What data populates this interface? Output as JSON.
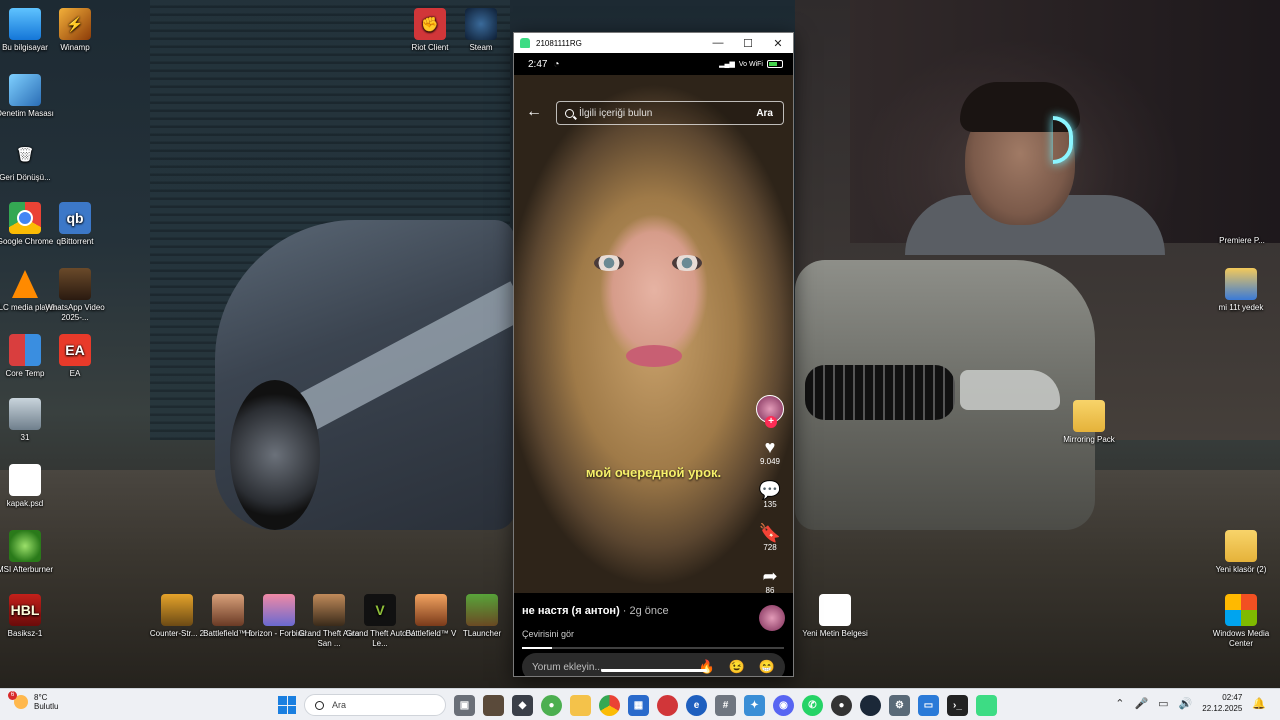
{
  "desktop": {
    "left_icons": [
      {
        "label": "Bu bilgisayar",
        "icon": "computer-icon"
      },
      {
        "label": "Winamp",
        "icon": "winamp-icon"
      },
      {
        "label": "Denetim Masası",
        "icon": "control-panel-icon"
      },
      {
        "label": "Geri Dönüşü...",
        "icon": "recycle-bin-icon"
      },
      {
        "label": "Google Chrome",
        "icon": "chrome-icon"
      },
      {
        "label": "qBittorrent",
        "icon": "qbittorrent-icon"
      },
      {
        "label": "VLC media player",
        "icon": "vlc-icon"
      },
      {
        "label": "WhatsApp Video 2025-...",
        "icon": "video-file-icon"
      },
      {
        "label": "Core Temp",
        "icon": "core-temp-icon"
      },
      {
        "label": "EA",
        "icon": "ea-icon"
      },
      {
        "label": "31",
        "icon": "image-file-icon"
      },
      {
        "label": "kapak.psd",
        "icon": "psd-file-icon"
      },
      {
        "label": "MSI Afterburner",
        "icon": "msi-afterburner-icon"
      },
      {
        "label": "Basiksz-1",
        "icon": "image-file-icon"
      }
    ],
    "top_icons": [
      {
        "label": "Riot Client",
        "icon": "riot-icon"
      },
      {
        "label": "Steam",
        "icon": "steam-icon"
      }
    ],
    "bottom_icons": [
      {
        "label": "Counter-Str... 2",
        "icon": "cs2-icon"
      },
      {
        "label": "Battlefield™ 1",
        "icon": "battlefield-1-icon"
      },
      {
        "label": "Horizon - Forbidd...",
        "icon": "horizon-icon"
      },
      {
        "label": "Grand Theft Auto San ...",
        "icon": "gta-sa-icon"
      },
      {
        "label": "Grand Theft Auto V Le...",
        "icon": "gta-v-icon"
      },
      {
        "label": "Battlefield™ V",
        "icon": "battlefield-v-icon"
      },
      {
        "label": "TLauncher",
        "icon": "tlauncher-icon"
      },
      {
        "label": "Yeni Metin Belgesi",
        "icon": "text-file-icon"
      }
    ],
    "right_icons": [
      {
        "label": "Premiere P...",
        "icon": "premiere-icon"
      },
      {
        "label": "mi 11t yedek",
        "icon": "folder-icon"
      },
      {
        "label": "Mirroring Pack",
        "icon": "folder-icon"
      },
      {
        "label": "Yeni klasör (2)",
        "icon": "folder-icon"
      },
      {
        "label": "Windows Media Center",
        "icon": "media-center-icon"
      }
    ]
  },
  "window": {
    "title": "21081111RG",
    "controls": [
      "—",
      "☐",
      "✕"
    ]
  },
  "phone": {
    "status_time": "2:47",
    "status_right": "Vo WiFi",
    "search_placeholder": "İlgili içeriği bulun",
    "search_button": "Ara",
    "caption": "мой очередной урок.",
    "likes": "9.049",
    "comments": "135",
    "saves": "728",
    "shares": "86",
    "username": "не настя (я антон)",
    "posted": "· 2g önce",
    "translate": "Çevirisini gör",
    "comment_placeholder": "Yorum ekleyin...",
    "emojis": [
      "🔥",
      "😉",
      "😁"
    ]
  },
  "taskbar": {
    "weather_temp": "8°C",
    "weather_desc": "Bulutlu",
    "weather_badge": "6",
    "search_placeholder": "Ara",
    "time": "02:47",
    "date": "22.12.2025"
  }
}
